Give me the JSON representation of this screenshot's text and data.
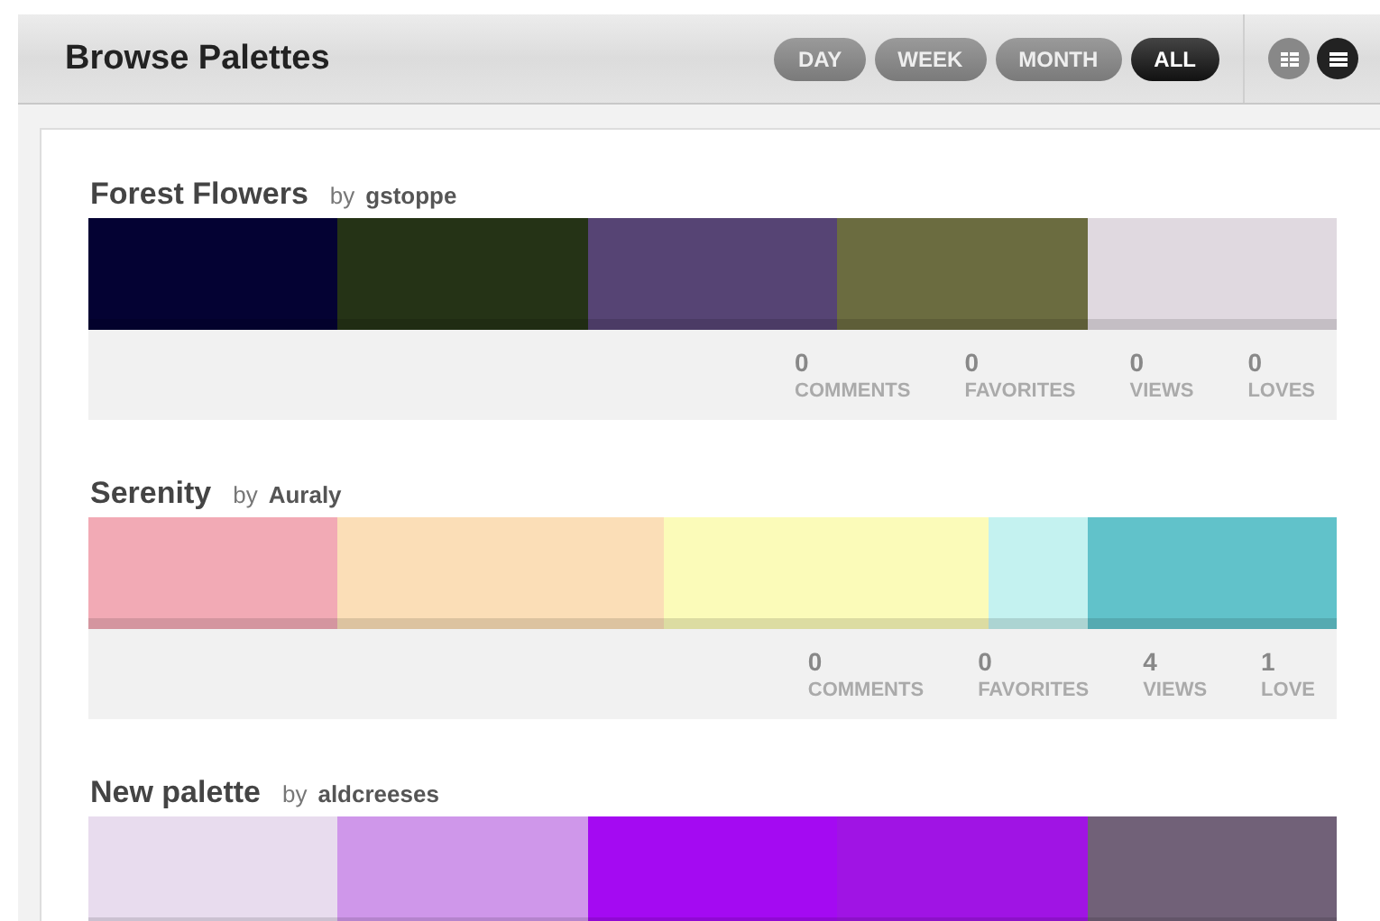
{
  "header": {
    "title": "Browse Palettes",
    "filters": [
      {
        "label": "DAY",
        "selected": false
      },
      {
        "label": "WEEK",
        "selected": false
      },
      {
        "label": "MONTH",
        "selected": false
      },
      {
        "label": "ALL",
        "selected": true
      }
    ],
    "views": [
      {
        "kind": "grid",
        "selected": false
      },
      {
        "kind": "list",
        "selected": true
      }
    ]
  },
  "palettes": [
    {
      "title": "Forest Flowers",
      "by": "by",
      "author": "gstoppe",
      "swatches": [
        {
          "color": "#040233",
          "kind": "standard"
        },
        {
          "color": "#253316",
          "kind": "standard"
        },
        {
          "color": "#564474",
          "kind": "standard"
        },
        {
          "color": "#6b6c40",
          "kind": "standard"
        },
        {
          "color": "#e0d9e0",
          "kind": "standard"
        }
      ],
      "stats": [
        {
          "value": "0",
          "label": "COMMENTS"
        },
        {
          "value": "0",
          "label": "FAVORITES"
        },
        {
          "value": "0",
          "label": "VIEWS"
        },
        {
          "value": "0",
          "label": "LOVES"
        }
      ]
    },
    {
      "title": "Serenity",
      "by": "by",
      "author": "Auraly",
      "swatches": [
        {
          "color": "#f2aab5",
          "kind": "standard"
        },
        {
          "color": "#fbdeb7",
          "kind": "wide"
        },
        {
          "color": "#fbfbb9",
          "kind": "wide"
        },
        {
          "color": "#c4f2f0",
          "kind": "narrow"
        },
        {
          "color": "#61c2ca",
          "kind": "standard"
        }
      ],
      "stats": [
        {
          "value": "0",
          "label": "COMMENTS"
        },
        {
          "value": "0",
          "label": "FAVORITES"
        },
        {
          "value": "4",
          "label": "VIEWS"
        },
        {
          "value": "1",
          "label": "LOVE"
        }
      ]
    },
    {
      "title": "New palette",
      "by": "by",
      "author": "aldcreeses",
      "swatches": [
        {
          "color": "#e8dcee",
          "kind": "standard"
        },
        {
          "color": "#cf97ea",
          "kind": "standard"
        },
        {
          "color": "#a40af2",
          "kind": "standard"
        },
        {
          "color": "#a014e4",
          "kind": "standard"
        },
        {
          "color": "#716178",
          "kind": "standard"
        }
      ]
    }
  ]
}
